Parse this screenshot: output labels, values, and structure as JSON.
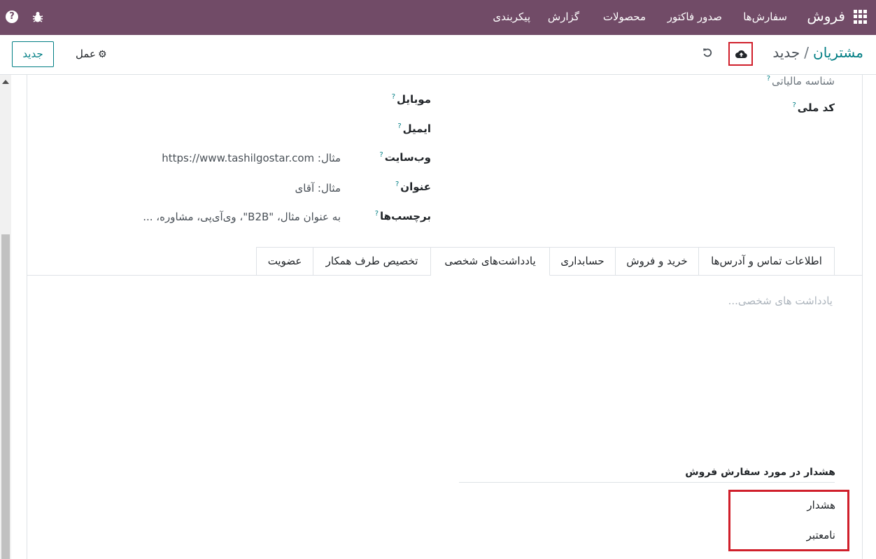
{
  "navbar": {
    "brand": "فروش",
    "menu": [
      "سفارش‌ها",
      "صدور فاکتور",
      "محصولات",
      "گزارش",
      "پیکربندی"
    ],
    "help_icon": "?"
  },
  "control_panel": {
    "breadcrumb_parent": "مشتریان",
    "breadcrumb_separator": "/",
    "breadcrumb_current": "جدید",
    "new_button": "جدید",
    "action_button": "عمل"
  },
  "form": {
    "tax_id_label": "شناسه مالیاتی",
    "national_code_label": "کد ملی",
    "mobile_label": "موبایل",
    "email_label": "ایمیل",
    "website_label": "وب‌سایت",
    "website_placeholder": "مثال: https://www.tashilgostar.com",
    "title_label": "عنوان",
    "title_placeholder": "مثال: آقای",
    "tags_label": "برچسب‌ها",
    "tags_placeholder": "به عنوان مثال، \"B2B\"، وی‌آی‌پی، مشاوره، ..."
  },
  "tabs": [
    {
      "label": "اطلاعات تماس و آدرس‌ها",
      "active": false
    },
    {
      "label": "خرید و فروش",
      "active": false
    },
    {
      "label": "حسابداری",
      "active": false
    },
    {
      "label": "یادداشت‌های شخصی",
      "active": true
    },
    {
      "label": "تخصیص طرف همکار",
      "active": false
    },
    {
      "label": "عضویت",
      "active": false
    }
  ],
  "notes": {
    "placeholder": "یادداشت های شخصی..."
  },
  "sale_warning": {
    "title": "هشدار در مورد سفارش فروش",
    "options": [
      "هشدار",
      "نامعتبر"
    ]
  },
  "colors": {
    "navbar": "#714b67",
    "accent": "#017e84",
    "highlight": "#d01f2b"
  }
}
